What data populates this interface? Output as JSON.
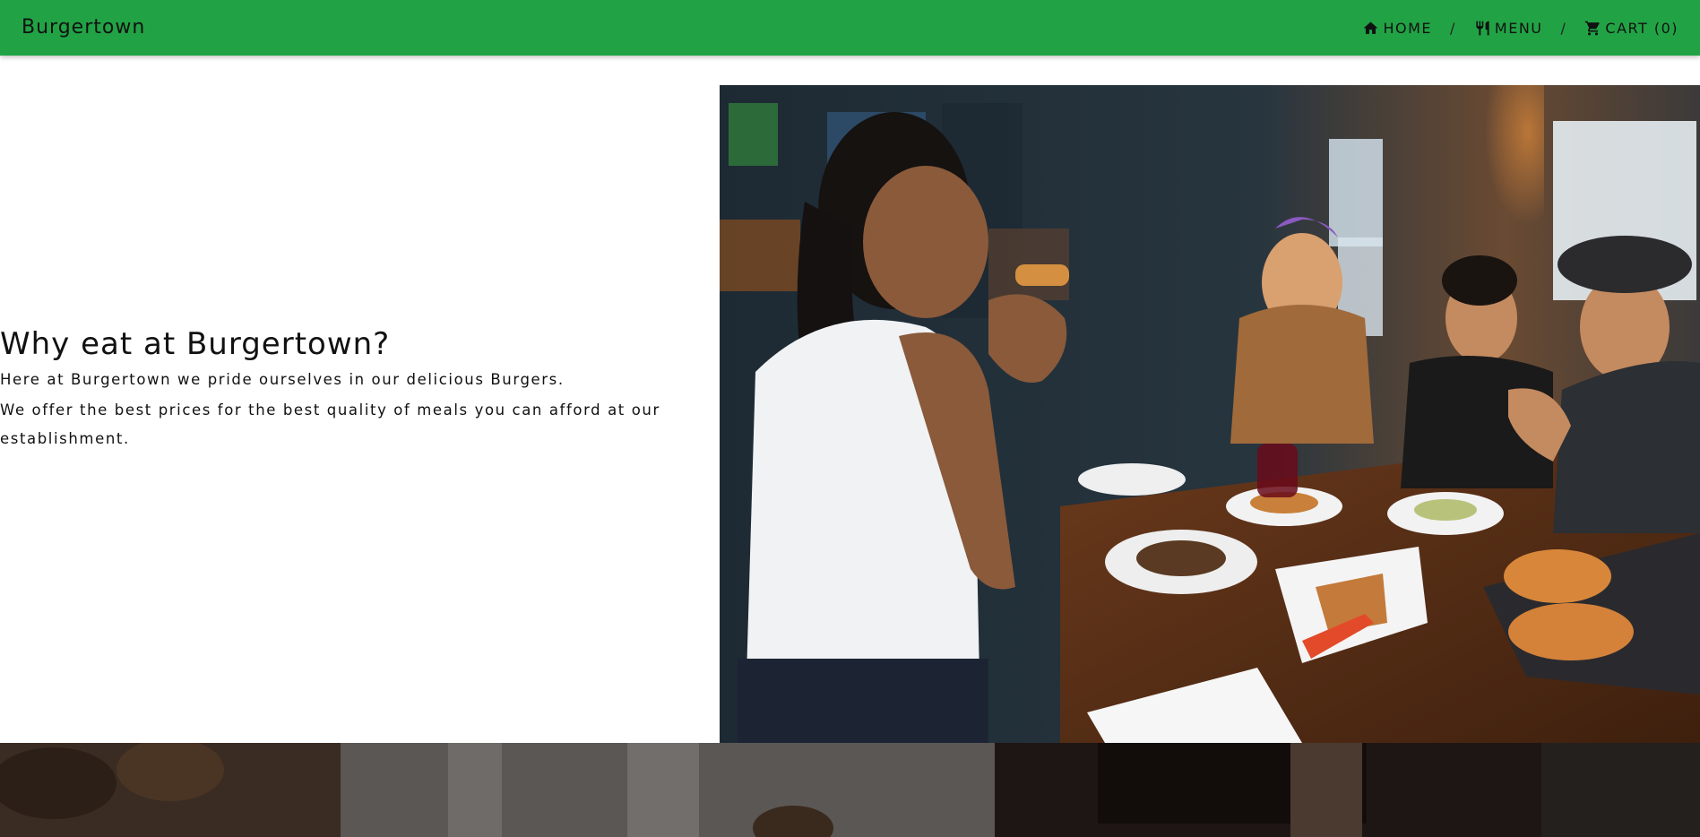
{
  "navbar": {
    "brand": "Burgertown",
    "links": [
      {
        "label": "HOME",
        "icon": "home-icon"
      },
      {
        "label": "MENU",
        "icon": "utensils-icon"
      },
      {
        "label": "CART (0)",
        "icon": "cart-icon"
      }
    ],
    "separator": "/",
    "background": "#21a345"
  },
  "hero": {
    "title": "Why eat at Burgertown?",
    "paragraphs": [
      "Here at Burgertown we pride ourselves in our delicious Burgers.",
      "We offer the best prices for the best quality of meals you can afford at our establishment."
    ]
  }
}
